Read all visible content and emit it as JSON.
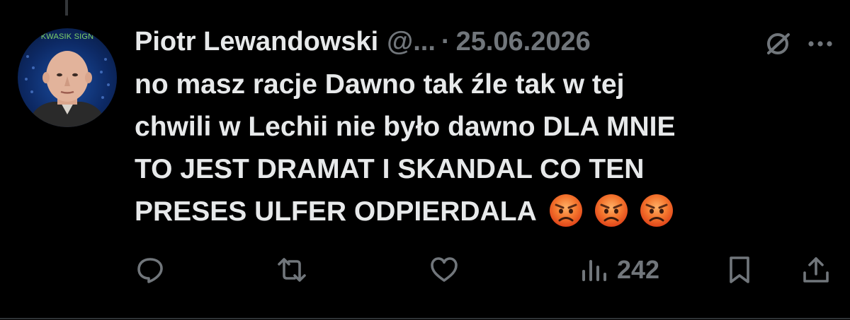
{
  "tweet": {
    "author_name": "Piotr Lewandowski",
    "author_handle": "@...",
    "separator": "·",
    "date": "25.06.2026",
    "avatar_banner": "KWASIK SIGN",
    "text_lines": [
      "no masz racje Dawno tak źle tak w tej",
      "chwili w Lechii nie było dawno DLA MNIE",
      "TO JEST DRAMAT I SKANDAL CO TEN",
      "PRESES ULFER ODPIERDALA"
    ],
    "emojis": [
      "angry-face",
      "angry-face",
      "angry-face"
    ]
  },
  "actions": {
    "reply_icon": "reply-icon",
    "retweet_icon": "retweet-icon",
    "like_icon": "heart-icon",
    "views_icon": "views-icon",
    "views_count": "242",
    "bookmark_icon": "bookmark-icon",
    "share_icon": "share-icon"
  },
  "colors": {
    "background": "#000000",
    "primary_text": "#e7e9ea",
    "secondary_text": "#71767b",
    "divider": "#2f3336"
  }
}
